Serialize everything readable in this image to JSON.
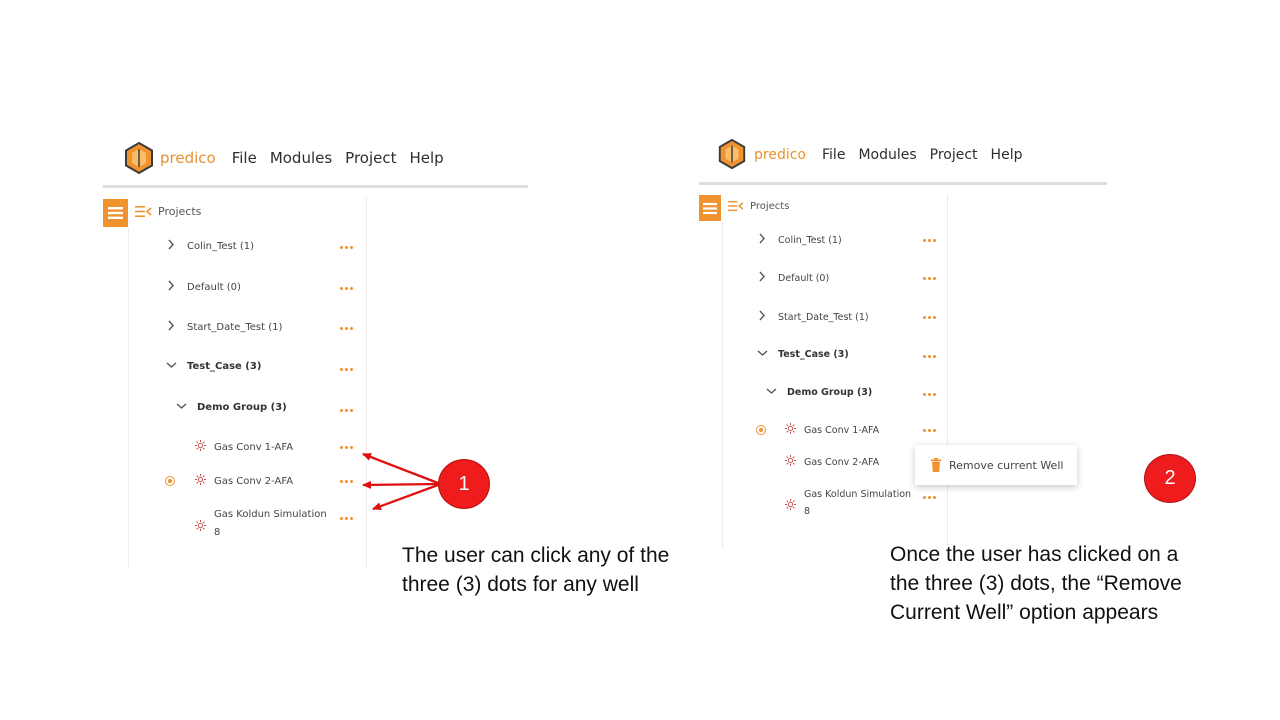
{
  "app": {
    "brand": "predico",
    "menu": [
      "File",
      "Modules",
      "Project",
      "Help"
    ]
  },
  "sidebar": {
    "title": "Projects",
    "icons": {
      "toggle": "list-icon",
      "collapse": "menu-collapse-icon"
    }
  },
  "left_tree": {
    "items": [
      {
        "label": "Colin_Test (1)",
        "type": "project",
        "expanded": false
      },
      {
        "label": "Default (0)",
        "type": "project",
        "expanded": false
      },
      {
        "label": "Start_Date_Test (1)",
        "type": "project",
        "expanded": false
      },
      {
        "label": "Test_Case (3)",
        "type": "project",
        "expanded": true
      },
      {
        "label": "Demo Group (3)",
        "type": "group",
        "expanded": true
      },
      {
        "label": "Gas Conv 1-AFA",
        "type": "well",
        "selected": false
      },
      {
        "label": "Gas Conv 2-AFA",
        "type": "well",
        "selected": true
      },
      {
        "label": "Gas Koldun Simulation",
        "label2": "8",
        "type": "well",
        "selected": false
      }
    ]
  },
  "right_tree": {
    "items": [
      {
        "label": "Colin_Test (1)",
        "type": "project",
        "expanded": false
      },
      {
        "label": "Default (0)",
        "type": "project",
        "expanded": false
      },
      {
        "label": "Start_Date_Test (1)",
        "type": "project",
        "expanded": false
      },
      {
        "label": "Test_Case (3)",
        "type": "project",
        "expanded": true
      },
      {
        "label": "Demo Group (3)",
        "type": "group",
        "expanded": true
      },
      {
        "label": "Gas Conv 1-AFA",
        "type": "well",
        "selected": true
      },
      {
        "label": "Gas Conv 2-AFA",
        "type": "well",
        "selected": false
      },
      {
        "label": "Gas Koldun Simulation",
        "label2": "8",
        "type": "well",
        "selected": false
      }
    ]
  },
  "context_menu": {
    "label": "Remove current Well",
    "icon": "trash-icon"
  },
  "annotations": {
    "badge1": "1",
    "badge2": "2",
    "caption1": [
      "The user can click any of the",
      "three (3) dots for any well"
    ],
    "caption2": [
      "Once the user has clicked on a",
      "the three (3) dots, the “Remove",
      "Current Well” option appears"
    ]
  },
  "colors": {
    "accent": "#f0922e",
    "badge": "#ee1c1c",
    "arrow": "#e01010"
  }
}
